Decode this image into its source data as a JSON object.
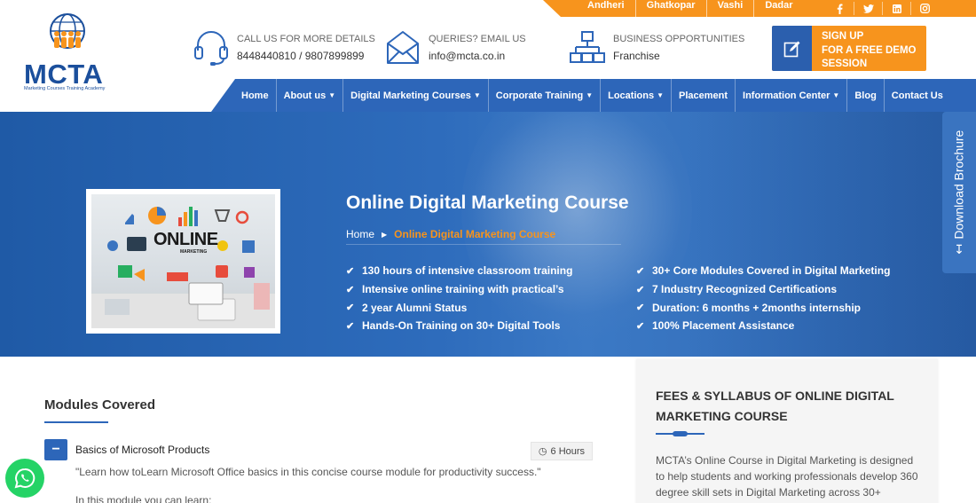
{
  "topbar": {
    "locations": [
      "Andheri",
      "Ghatkopar",
      "Vashi",
      "Dadar"
    ],
    "social": [
      {
        "name": "facebook-icon",
        "glyph": "f"
      },
      {
        "name": "twitter-icon",
        "glyph": "t"
      },
      {
        "name": "linkedin-icon",
        "glyph": "in"
      },
      {
        "name": "instagram-icon",
        "glyph": "◎"
      }
    ]
  },
  "logo": {
    "brand": "MCTA",
    "tagline": "Marketing Courses Training Academy"
  },
  "contacts": {
    "call": {
      "label": "CALL US FOR MORE DETAILS",
      "value": "8448440810 / 9807899899"
    },
    "email": {
      "label": "QUERIES? EMAIL US",
      "value": "info@mcta.co.in"
    },
    "business": {
      "label": "BUSINESS OPPORTUNITIES",
      "value": "Franchise"
    }
  },
  "demo": {
    "line1": "SIGN UP",
    "line2": "FOR A FREE DEMO",
    "line3": "SESSION"
  },
  "nav": [
    {
      "label": "Home",
      "dropdown": false
    },
    {
      "label": "About us",
      "dropdown": true
    },
    {
      "label": "Digital Marketing Courses",
      "dropdown": true
    },
    {
      "label": "Corporate Training",
      "dropdown": true
    },
    {
      "label": "Locations",
      "dropdown": true
    },
    {
      "label": "Placement",
      "dropdown": false
    },
    {
      "label": "Information Center",
      "dropdown": true
    },
    {
      "label": "Blog",
      "dropdown": false
    },
    {
      "label": "Contact Us",
      "dropdown": false
    }
  ],
  "hero": {
    "image_text": "ONLINE",
    "image_subtext": "MARKETING",
    "title": "Online Digital Marketing Course",
    "breadcrumb": {
      "home": "Home",
      "current": "Online Digital Marketing Course"
    },
    "features_left": [
      "130 hours of intensive classroom training",
      "Intensive online training with practical’s",
      "2 year Alumni Status",
      "Hands-On Training on 30+ Digital Tools"
    ],
    "features_right": [
      "30+ Core Modules Covered in Digital Marketing",
      "7 Industry Recognized Certifications",
      "Duration: 6 months + 2months internship",
      "100% Placement Assistance"
    ]
  },
  "brochure": {
    "label": "Download Brochure"
  },
  "modules": {
    "title": "Modules Covered",
    "toggle": "−",
    "first": {
      "name": "Basics of Microsoft Products",
      "hours": "6 Hours",
      "quote": "\"Learn how toLearn Microsoft Office basics in this concise course module for productivity success.\"",
      "learn": "In this module you can learn:"
    }
  },
  "card": {
    "title": "FEES & SYLLABUS OF ONLINE DIGITAL MARKETING COURSE",
    "body": "MCTA’s Online Course in Digital Marketing is designed to help students and working professionals develop 360 degree skill sets in Digital Marketing across 30+"
  },
  "colors": {
    "orange": "#f7941d",
    "blue": "#2d66b9",
    "navy": "#1b4f9c",
    "whatsapp": "#25d366"
  }
}
